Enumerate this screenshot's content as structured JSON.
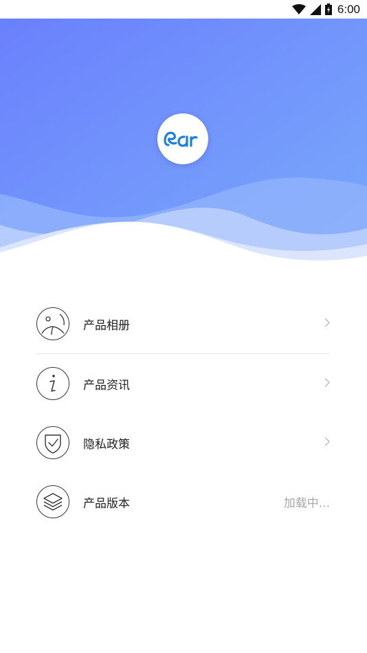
{
  "status_bar": {
    "time": "6:00",
    "icons": [
      "wifi-icon",
      "signal-icon",
      "battery-icon"
    ]
  },
  "app": {
    "logo_text": "ear"
  },
  "menu": {
    "items": [
      {
        "label": "产品相册",
        "icon": "gallery-icon",
        "trailing": "chevron"
      },
      {
        "label": "产品资讯",
        "icon": "info-icon",
        "trailing": "chevron"
      },
      {
        "label": "隐私政策",
        "icon": "shield-icon",
        "trailing": "chevron"
      },
      {
        "label": "产品版本",
        "icon": "layers-icon",
        "trailing": "value",
        "value": "加载中..."
      }
    ]
  },
  "colors": {
    "hero_gradient_start": "#6a84fc",
    "hero_gradient_end": "#79a6fb",
    "logo_blue": "#1b7fe0"
  }
}
